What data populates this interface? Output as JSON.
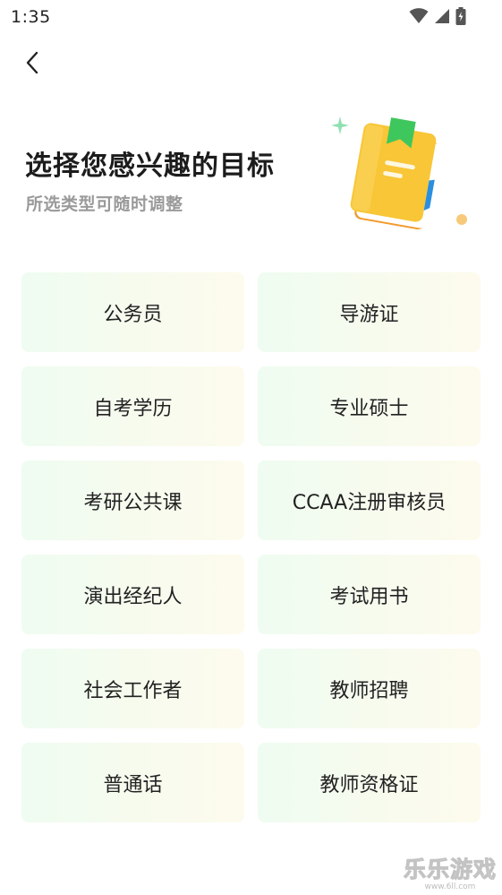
{
  "status_bar": {
    "time": "1:35",
    "icons": [
      "wifi-icon",
      "cell-signal-icon",
      "battery-charging-icon"
    ]
  },
  "nav": {
    "back_icon": "chevron-left-icon"
  },
  "header": {
    "title": "选择您感兴趣的目标",
    "subtitle": "所选类型可随时调整",
    "illustration": "book-illustration"
  },
  "categories": [
    {
      "label": "公务员"
    },
    {
      "label": "导游证"
    },
    {
      "label": "自考学历"
    },
    {
      "label": "专业硕士"
    },
    {
      "label": "考研公共课"
    },
    {
      "label": "CCAA注册审核员"
    },
    {
      "label": "演出经纪人"
    },
    {
      "label": "考试用书"
    },
    {
      "label": "社会工作者"
    },
    {
      "label": "教师招聘"
    },
    {
      "label": "普通话"
    },
    {
      "label": "教师资格证"
    }
  ],
  "watermark": {
    "text": "乐乐游戏",
    "url": "www.6ll.com"
  },
  "colors": {
    "card_green": "#effcf1",
    "card_cream": "#fdfbed",
    "book_yellow": "#f8c636",
    "book_orange": "#f39a2c",
    "bookmark_green": "#3ec75c",
    "subtitle_gray": "#9a9a9a"
  }
}
